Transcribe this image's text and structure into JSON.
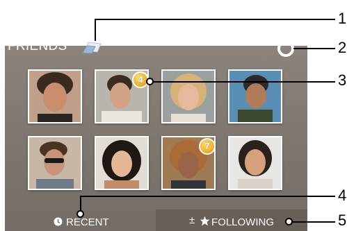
{
  "header": {
    "title": "FRIENDS"
  },
  "photos": [
    {
      "name": "friend-1"
    },
    {
      "name": "friend-2",
      "badge": "4"
    },
    {
      "name": "friend-3"
    },
    {
      "name": "friend-4"
    },
    {
      "name": "friend-5"
    },
    {
      "name": "friend-6"
    },
    {
      "name": "friend-7",
      "badge": "7"
    },
    {
      "name": "friend-8"
    }
  ],
  "bottom": {
    "recent_label": "RECENT",
    "following_label": "FOLLOWING",
    "following_prefix": "±"
  },
  "callouts": [
    "1",
    "2",
    "3",
    "4",
    "5"
  ],
  "colors": {
    "panel": "#857d76",
    "badge": "#f3b52a",
    "following_bg": "#676059"
  }
}
